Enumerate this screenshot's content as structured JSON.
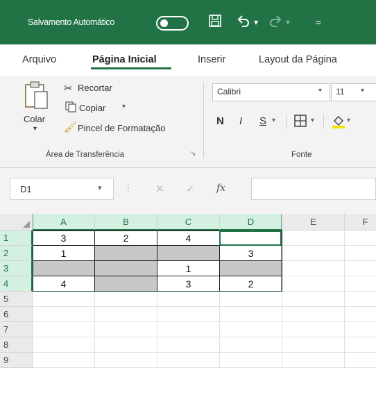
{
  "titlebar": {
    "autosave_label": "Salvamento Automático",
    "autosave_state": "Desativado",
    "accent": "#217346",
    "icons": [
      "save-icon",
      "undo-icon",
      "redo-icon",
      "customize-qat-icon"
    ]
  },
  "tabs": [
    {
      "label": "Arquivo",
      "active": false
    },
    {
      "label": "Página Inicial",
      "active": true
    },
    {
      "label": "Inserir",
      "active": false
    },
    {
      "label": "Layout da Página",
      "active": false
    }
  ],
  "ribbon": {
    "clipboard": {
      "paste_label": "Colar",
      "cut_label": "Recortar",
      "copy_label": "Copiar",
      "format_painter_label": "Pincel de Formatação",
      "group_label": "Área de Transferência"
    },
    "font": {
      "font_name": "Calibri",
      "font_size": "11",
      "bold_label": "N",
      "italic_label": "I",
      "underline_label": "S",
      "group_label": "Fonte"
    }
  },
  "formula_bar": {
    "name_box": "D1",
    "fx_label": "fx",
    "formula": ""
  },
  "grid": {
    "columns": [
      "A",
      "B",
      "C",
      "D",
      "E",
      "F"
    ],
    "rows": [
      "1",
      "2",
      "3",
      "4",
      "5",
      "6",
      "7",
      "8",
      "9"
    ],
    "active_cell": "D1",
    "cells": [
      [
        "3",
        "2",
        "4",
        ""
      ],
      [
        "1",
        "",
        "",
        "3"
      ],
      [
        "",
        "",
        "1",
        ""
      ],
      [
        "4",
        "",
        "3",
        "2"
      ]
    ],
    "shaded": [
      [
        false,
        false,
        false,
        false
      ],
      [
        false,
        true,
        true,
        false
      ],
      [
        true,
        true,
        false,
        true
      ],
      [
        false,
        true,
        false,
        false
      ]
    ],
    "shade_color": "#c8c8c8"
  }
}
